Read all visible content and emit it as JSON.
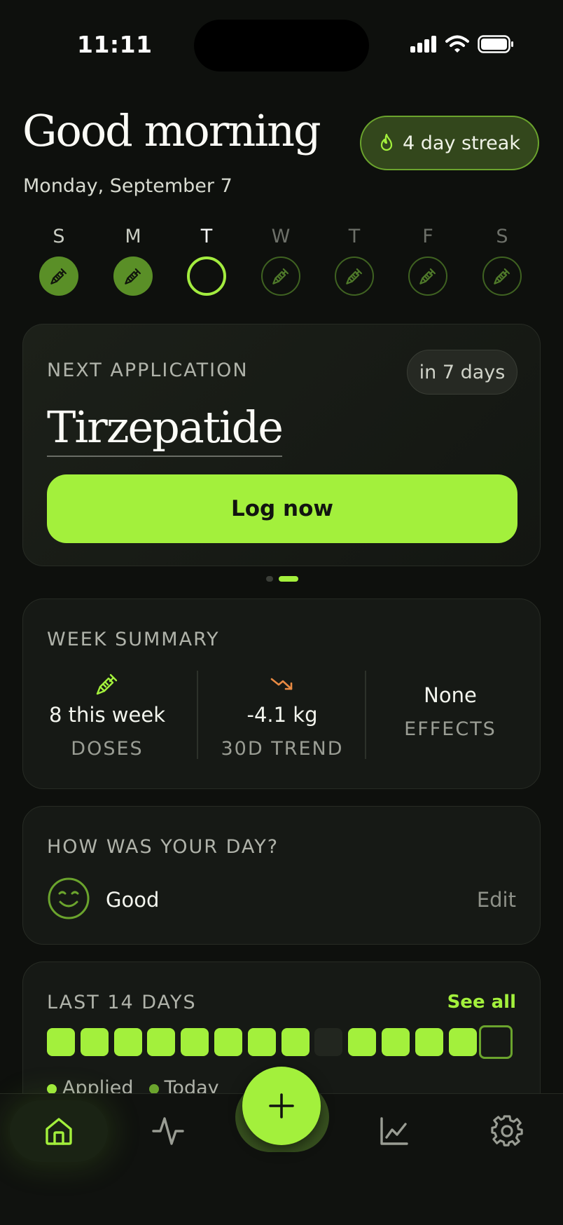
{
  "status": {
    "time": "11:11"
  },
  "header": {
    "greeting": "Good morning",
    "date": "Monday, September 7",
    "streak_label": "4 day streak"
  },
  "week": [
    {
      "letter": "S",
      "state": "done"
    },
    {
      "letter": "M",
      "state": "done"
    },
    {
      "letter": "T",
      "state": "today"
    },
    {
      "letter": "W",
      "state": "future"
    },
    {
      "letter": "T",
      "state": "future"
    },
    {
      "letter": "F",
      "state": "future"
    },
    {
      "letter": "S",
      "state": "future"
    }
  ],
  "next_application": {
    "label": "NEXT APPLICATION",
    "when": "in 7 days",
    "medication": "Tirzepatide",
    "button": "Log now"
  },
  "week_summary": {
    "label": "WEEK SUMMARY",
    "stats": [
      {
        "value": "8 this week",
        "caption": "DOSES",
        "icon": "syringe-icon"
      },
      {
        "value": "-4.1 kg",
        "caption": "30D TREND",
        "icon": "trend-down-icon"
      },
      {
        "value": "None",
        "caption": "EFFECTS",
        "icon": ""
      }
    ]
  },
  "mood": {
    "label": "HOW WAS YOUR DAY?",
    "value": "Good",
    "edit": "Edit"
  },
  "last_days": {
    "label": "LAST 14 DAYS",
    "see_all": "See all",
    "days": [
      "applied",
      "applied",
      "applied",
      "applied",
      "applied",
      "applied",
      "applied",
      "applied",
      "missed",
      "applied",
      "applied",
      "applied",
      "applied",
      "today"
    ],
    "legend": [
      {
        "label": "Applied",
        "color": "#a3f03c"
      },
      {
        "label": "Today",
        "color": "#6ba42d"
      }
    ]
  },
  "tabs": [
    {
      "name": "home",
      "icon": "home-icon",
      "active": true
    },
    {
      "name": "activity",
      "icon": "activity-icon",
      "active": false
    },
    {
      "name": "add",
      "icon": "plus-icon",
      "active": false
    },
    {
      "name": "progress",
      "icon": "chart-icon",
      "active": false
    },
    {
      "name": "settings",
      "icon": "gear-icon",
      "active": false
    }
  ],
  "colors": {
    "accent": "#a3f03c",
    "accent_dark": "#5a8f27",
    "background": "#0e100d",
    "card": "#161915",
    "trend": "#e88a43"
  }
}
